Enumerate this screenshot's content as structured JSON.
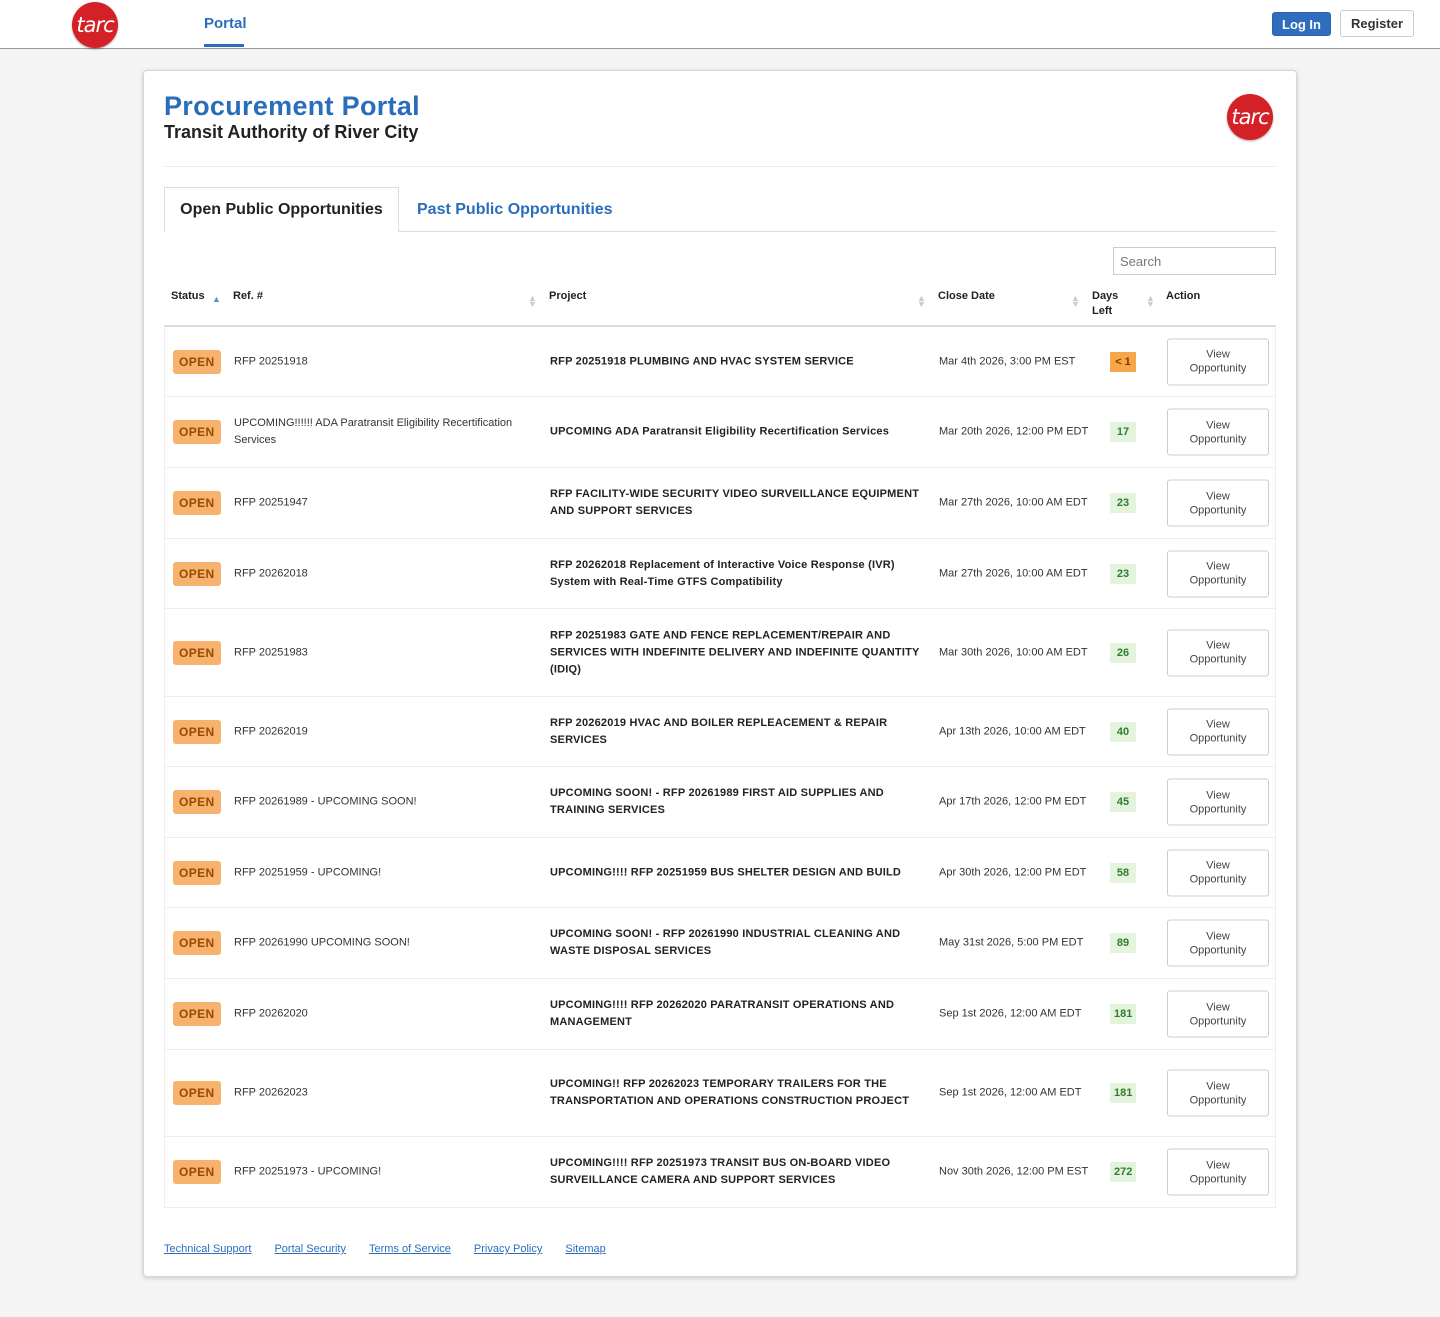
{
  "nav": {
    "logo_text": "tarc",
    "portal_link": "Portal",
    "login_label": "Log In",
    "register_label": "Register"
  },
  "header": {
    "title": "Procurement Portal",
    "org": "Transit Authority of River City",
    "logo_text": "tarc"
  },
  "tabs": [
    {
      "label": "Open Public Opportunities",
      "active": true
    },
    {
      "label": "Past Public Opportunities",
      "active": false
    }
  ],
  "search": {
    "placeholder": "Search"
  },
  "table": {
    "columns": [
      "Status",
      "Ref. #",
      "Project",
      "Close Date",
      "Days Left",
      "Action"
    ],
    "action_label": "View Opportunity",
    "rows": [
      {
        "status": "OPEN",
        "ref": "RFP 20251918",
        "project": "RFP 20251918 PLUMBING AND HVAC SYSTEM SERVICE",
        "close": "Mar 4th 2026, 3:00 PM EST",
        "days": "< 1",
        "urgent": true
      },
      {
        "status": "OPEN",
        "ref": "UPCOMING!!!!!! ADA Paratransit Eligibility Recertification Services",
        "project": "UPCOMING ADA Paratransit Eligibility Recertification Services",
        "close": "Mar 20th 2026, 12:00 PM EDT",
        "days": "17",
        "urgent": false
      },
      {
        "status": "OPEN",
        "ref": "RFP 20251947",
        "project": "RFP FACILITY-WIDE SECURITY VIDEO SURVEILLANCE EQUIPMENT AND SUPPORT SERVICES",
        "close": "Mar 27th 2026, 10:00 AM EDT",
        "days": "23",
        "urgent": false
      },
      {
        "status": "OPEN",
        "ref": "RFP 20262018",
        "project": "RFP 20262018 Replacement of Interactive Voice Response (IVR) System with Real-Time GTFS Compatibility",
        "close": "Mar 27th 2026, 10:00 AM EDT",
        "days": "23",
        "urgent": false
      },
      {
        "status": "OPEN",
        "ref": "RFP 20251983",
        "project": "RFP 20251983 GATE AND FENCE REPLACEMENT/REPAIR AND SERVICES WITH INDEFINITE DELIVERY AND INDEFINITE QUANTITY (IDIQ)",
        "close": "Mar 30th 2026, 10:00 AM EDT",
        "days": "26",
        "urgent": false
      },
      {
        "status": "OPEN",
        "ref": "RFP 20262019",
        "project": "RFP 20262019 HVAC AND BOILER REPLEACEMENT & REPAIR SERVICES",
        "close": "Apr 13th 2026, 10:00 AM EDT",
        "days": "40",
        "urgent": false
      },
      {
        "status": "OPEN",
        "ref": "RFP 20261989 - UPCOMING SOON!",
        "project": "UPCOMING SOON! - RFP 20261989 FIRST AID SUPPLIES AND TRAINING SERVICES",
        "close": "Apr 17th 2026, 12:00 PM EDT",
        "days": "45",
        "urgent": false
      },
      {
        "status": "OPEN",
        "ref": "RFP 20251959 - UPCOMING!",
        "project": "UPCOMING!!!! RFP 20251959 BUS SHELTER DESIGN AND BUILD",
        "close": "Apr 30th 2026, 12:00 PM EDT",
        "days": "58",
        "urgent": false
      },
      {
        "status": "OPEN",
        "ref": "RFP 20261990 UPCOMING SOON!",
        "project": "UPCOMING SOON! - RFP 20261990 INDUSTRIAL CLEANING AND WASTE DISPOSAL SERVICES",
        "close": "May 31st 2026, 5:00 PM EDT",
        "days": "89",
        "urgent": false
      },
      {
        "status": "OPEN",
        "ref": "RFP 20262020",
        "project": "UPCOMING!!!! RFP 20262020 PARATRANSIT OPERATIONS AND MANAGEMENT",
        "close": "Sep 1st 2026, 12:00 AM EDT",
        "days": "181",
        "urgent": false
      },
      {
        "status": "OPEN",
        "ref": "RFP 20262023",
        "project": "UPCOMING!! RFP 20262023 TEMPORARY TRAILERS FOR THE TRANSPORTATION AND OPERATIONS CONSTRUCTION PROJECT",
        "close": "Sep 1st 2026, 12:00 AM EDT",
        "days": "181",
        "urgent": false
      },
      {
        "status": "OPEN",
        "ref": "RFP 20251973 - UPCOMING!",
        "project": "UPCOMING!!!! RFP 20251973 TRANSIT BUS ON-BOARD VIDEO SURVEILLANCE CAMERA AND SUPPORT SERVICES",
        "close": "Nov 30th 2026, 12:00 PM EST",
        "days": "272",
        "urgent": false
      }
    ]
  },
  "footer": {
    "links": [
      "Technical Support",
      "Portal Security",
      "Terms of Service",
      "Privacy Policy",
      "Sitemap"
    ]
  },
  "colors": {
    "brand_red": "#d42027",
    "link_blue": "#2a6ebb",
    "open_badge": "#f7b26d",
    "days_ok": "#e3f3dc",
    "days_urgent": "#f7a64a"
  }
}
